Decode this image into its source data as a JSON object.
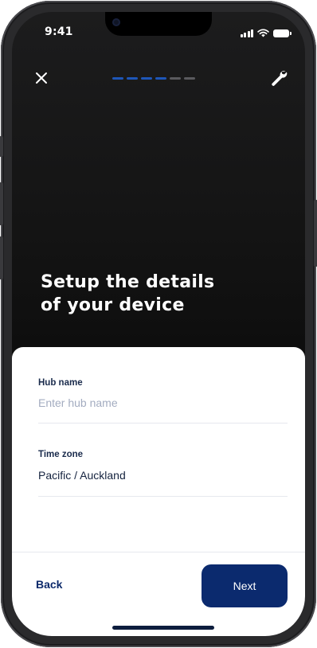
{
  "status_bar": {
    "time": "9:41",
    "icons": [
      "signal-icon",
      "wifi-icon",
      "battery-icon"
    ]
  },
  "header": {
    "close_icon": "close-icon",
    "settings_icon": "wrench-icon",
    "progress": {
      "total_steps": 6,
      "completed_steps": 4
    }
  },
  "hero": {
    "title_line1": "Setup the details",
    "title_line2": "of your device"
  },
  "form": {
    "hub_name": {
      "label": "Hub name",
      "placeholder": "Enter hub name",
      "value": ""
    },
    "time_zone": {
      "label": "Time zone",
      "value": "Pacific / Auckland"
    }
  },
  "footer": {
    "back_label": "Back",
    "next_label": "Next"
  },
  "colors": {
    "accent": "#0b2a6e",
    "progress_active": "#1e56b8",
    "progress_inactive": "#5a5a5e",
    "text_dark": "#15233f",
    "placeholder": "#a3acc0"
  }
}
